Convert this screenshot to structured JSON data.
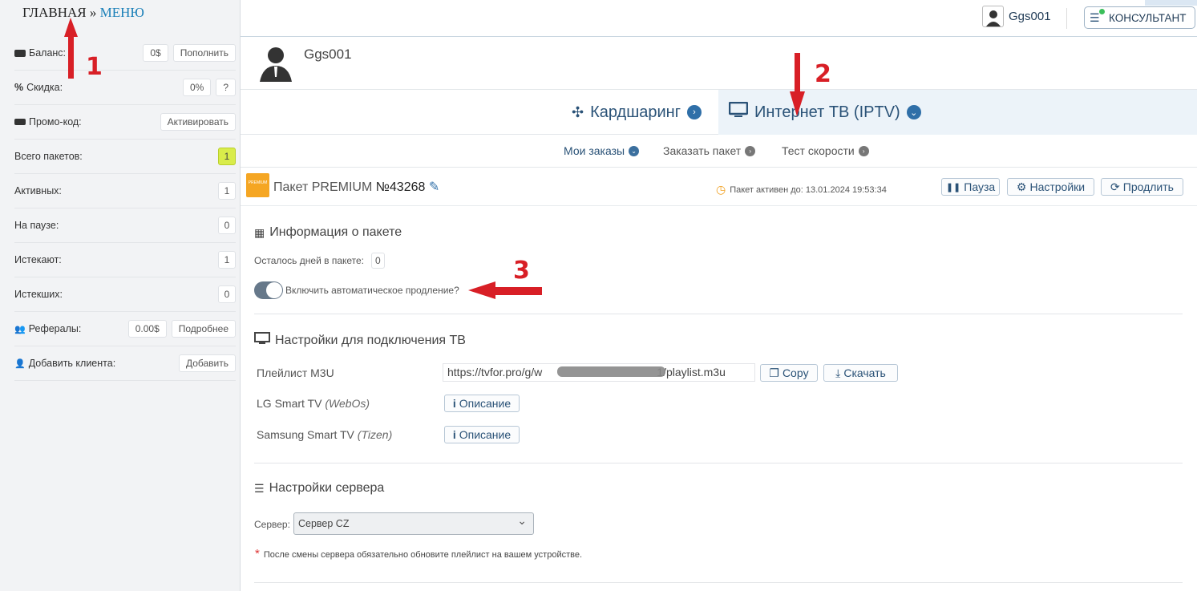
{
  "breadcrumb": {
    "home": "ГЛАВНАЯ",
    "sep": "»",
    "menu": "МЕНЮ"
  },
  "sidebar": {
    "rows": [
      {
        "label": "Баланс:",
        "value": "0$",
        "action": "Пополнить"
      },
      {
        "label": "Скидка:",
        "value": "0%",
        "action": "?"
      },
      {
        "label": "Промо-код:",
        "action": "Активировать"
      },
      {
        "label": "Всего пакетов:",
        "value": "1"
      },
      {
        "label": "Активных:",
        "value": "1"
      },
      {
        "label": "На паузе:",
        "value": "0"
      },
      {
        "label": "Истекают:",
        "value": "1"
      },
      {
        "label": "Истекших:",
        "value": "0"
      },
      {
        "label": "Рефералы:",
        "value": "0.00$",
        "action": "Подробнее"
      },
      {
        "label": "Добавить клиента:",
        "action": "Добавить"
      }
    ]
  },
  "header": {
    "username": "Ggs001",
    "consultant": "КОНСУЛЬТАНТ"
  },
  "profile": {
    "name": "Ggs001"
  },
  "tabs": [
    {
      "label": "Кардшаринг"
    },
    {
      "label": "Интернет ТВ (IPTV)"
    }
  ],
  "subtabs": [
    {
      "label": "Мои заказы"
    },
    {
      "label": "Заказать пакет"
    },
    {
      "label": "Тест скорости"
    }
  ],
  "package": {
    "icon_text": "PREMIUM",
    "title": "Пакет PREMIUM",
    "number": "№43268",
    "active_until": "Пакет активен до: 13.01.2024 19:53:34",
    "buttons": {
      "pause": "Пауза",
      "settings": "Настройки",
      "extend": "Продлить"
    }
  },
  "info": {
    "title": "Информация о пакете",
    "days_label": "Осталось дней в пакете:",
    "days_value": "0",
    "auto_renew_label": "Включить автоматическое продление?",
    "auto_renew_on": true
  },
  "tv_settings": {
    "title": "Настройки для подключения ТВ",
    "playlist_label": "Плейлист M3U",
    "playlist_prefix": "https://tvfor.pro/g/w",
    "playlist_suffix": "1/playlist.m3u",
    "copy": "Copy",
    "download": "Скачать",
    "lg_label": "LG Smart TV",
    "lg_os": "(WebOs)",
    "samsung_label": "Samsung Smart TV",
    "samsung_os": "(Tizen)",
    "description": "Описание"
  },
  "server": {
    "title": "Настройки сервера",
    "label": "Сервер:",
    "selected": "Сервер CZ",
    "note_mark": "*",
    "note": "После смены сервера обязательно обновите плейлист на вашем устройстве."
  },
  "annotations": {
    "a1": "1",
    "a2": "2",
    "a3": "3"
  },
  "colors": {
    "annotation": "#d81f26",
    "accent": "#2a5277",
    "package_badge": "#f5a623"
  }
}
